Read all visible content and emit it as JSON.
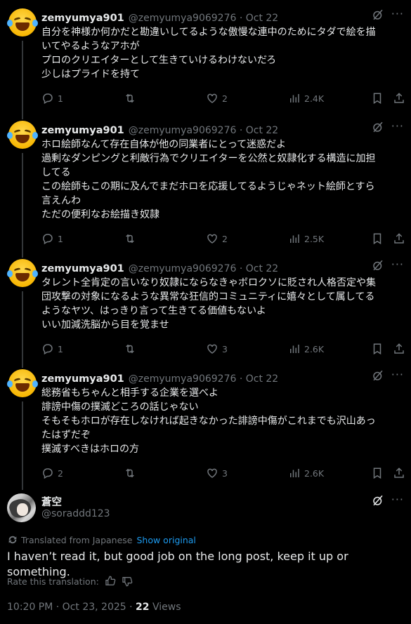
{
  "tweets": [
    {
      "name": "zemyumya901",
      "handle": "@zemyumya9069276 · Oct 22",
      "text": "自分を神様か何かだと勘違いしてるような傲慢な連中のためにタダで絵を描\nいてやるようなアホが\nプロのクリエイターとして生きていけるわけないだろ\n少しはプライドを持て",
      "replies": "1",
      "reposts": "",
      "likes": "2",
      "views": "2.4K"
    },
    {
      "name": "zemyumya901",
      "handle": "@zemyumya9069276 · Oct 22",
      "text": "ホロ絵師なんて存在自体が他の同業者にとって迷惑だよ\n過剰なダンピングと利敵行為でクリエイターを公然と奴隷化する構造に加担\nしてる\nこの絵師もこの期に及んでまだホロを応援してるようじゃネット絵師とすら\n言えんわ\nただの便利なお絵描き奴隷",
      "replies": "1",
      "reposts": "",
      "likes": "2",
      "views": "2.5K"
    },
    {
      "name": "zemyumya901",
      "handle": "@zemyumya9069276 · Oct 22",
      "text": "タレント全肯定の言いなり奴隷にならなきゃボロクソに貶され人格否定や集\n団攻撃の対象になるような異常な狂信的コミュニティに嬉々として属してる\nようなヤツ、はっきり言って生きてる価値もないよ\nいい加減洗脳から目を覚ませ",
      "replies": "1",
      "reposts": "",
      "likes": "3",
      "views": "2.6K"
    },
    {
      "name": "zemyumya901",
      "handle": "@zemyumya9069276 · Oct 22",
      "text": "総務省もちゃんと相手する企業を選べよ\n誹謗中傷の撲滅どころの話じゃない\nそもそもホロが存在しなければ起きなかった誹謗中傷がこれまでも沢山あっ\nたはずだぞ\n撲滅すべきはホロの方",
      "replies": "2",
      "reposts": "",
      "likes": "3",
      "views": "2.6K"
    }
  ],
  "main_post": {
    "name": "蒼空",
    "handle": "@soraddd123",
    "translated_from": "Translated from Japanese",
    "show_original": "Show original",
    "translation": "I haven’t read it, but good job on the long post, keep it up or something.",
    "rate_label": "Rate this translation:",
    "timestamp": "10:20 PM · Oct 23, 2025 · ",
    "views_count": "22",
    "views_label": " Views"
  },
  "icons": {
    "reply": "reply-icon",
    "repost": "repost-icon",
    "like": "heart-icon",
    "views": "views-icon",
    "bookmark": "bookmark-icon",
    "share": "share-icon",
    "grok": "grok-icon",
    "more": "more-icon"
  },
  "colors": {
    "background": "#000000",
    "text": "#e7e9ea",
    "muted": "#71767b",
    "link": "#1d9bf0",
    "thread_line": "#333639"
  }
}
